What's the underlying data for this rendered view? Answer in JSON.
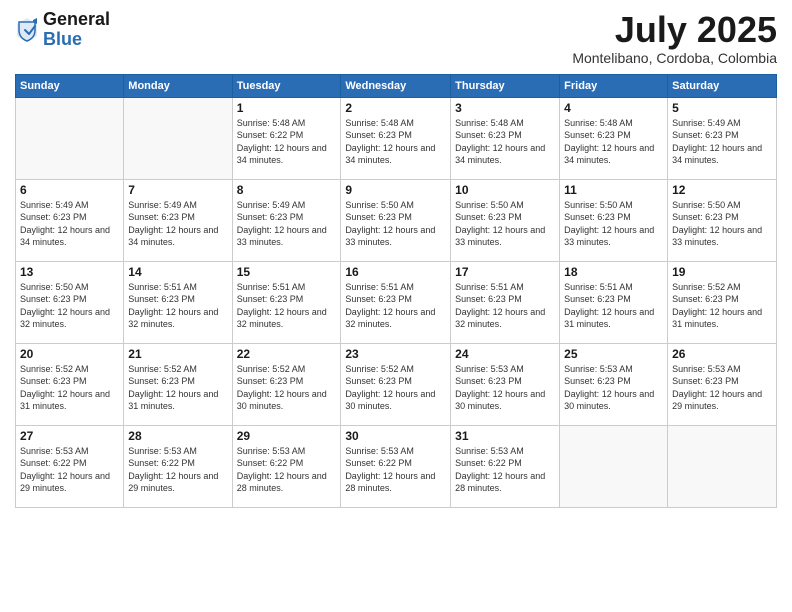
{
  "header": {
    "logo_general": "General",
    "logo_blue": "Blue",
    "month_title": "July 2025",
    "location": "Montelibano, Cordoba, Colombia"
  },
  "weekdays": [
    "Sunday",
    "Monday",
    "Tuesday",
    "Wednesday",
    "Thursday",
    "Friday",
    "Saturday"
  ],
  "weeks": [
    [
      {
        "day": "",
        "empty": true
      },
      {
        "day": "",
        "empty": true
      },
      {
        "day": "1",
        "sunrise": "5:48 AM",
        "sunset": "6:22 PM",
        "daylight": "12 hours and 34 minutes."
      },
      {
        "day": "2",
        "sunrise": "5:48 AM",
        "sunset": "6:23 PM",
        "daylight": "12 hours and 34 minutes."
      },
      {
        "day": "3",
        "sunrise": "5:48 AM",
        "sunset": "6:23 PM",
        "daylight": "12 hours and 34 minutes."
      },
      {
        "day": "4",
        "sunrise": "5:48 AM",
        "sunset": "6:23 PM",
        "daylight": "12 hours and 34 minutes."
      },
      {
        "day": "5",
        "sunrise": "5:49 AM",
        "sunset": "6:23 PM",
        "daylight": "12 hours and 34 minutes."
      }
    ],
    [
      {
        "day": "6",
        "sunrise": "5:49 AM",
        "sunset": "6:23 PM",
        "daylight": "12 hours and 34 minutes."
      },
      {
        "day": "7",
        "sunrise": "5:49 AM",
        "sunset": "6:23 PM",
        "daylight": "12 hours and 34 minutes."
      },
      {
        "day": "8",
        "sunrise": "5:49 AM",
        "sunset": "6:23 PM",
        "daylight": "12 hours and 33 minutes."
      },
      {
        "day": "9",
        "sunrise": "5:50 AM",
        "sunset": "6:23 PM",
        "daylight": "12 hours and 33 minutes."
      },
      {
        "day": "10",
        "sunrise": "5:50 AM",
        "sunset": "6:23 PM",
        "daylight": "12 hours and 33 minutes."
      },
      {
        "day": "11",
        "sunrise": "5:50 AM",
        "sunset": "6:23 PM",
        "daylight": "12 hours and 33 minutes."
      },
      {
        "day": "12",
        "sunrise": "5:50 AM",
        "sunset": "6:23 PM",
        "daylight": "12 hours and 33 minutes."
      }
    ],
    [
      {
        "day": "13",
        "sunrise": "5:50 AM",
        "sunset": "6:23 PM",
        "daylight": "12 hours and 32 minutes."
      },
      {
        "day": "14",
        "sunrise": "5:51 AM",
        "sunset": "6:23 PM",
        "daylight": "12 hours and 32 minutes."
      },
      {
        "day": "15",
        "sunrise": "5:51 AM",
        "sunset": "6:23 PM",
        "daylight": "12 hours and 32 minutes."
      },
      {
        "day": "16",
        "sunrise": "5:51 AM",
        "sunset": "6:23 PM",
        "daylight": "12 hours and 32 minutes."
      },
      {
        "day": "17",
        "sunrise": "5:51 AM",
        "sunset": "6:23 PM",
        "daylight": "12 hours and 32 minutes."
      },
      {
        "day": "18",
        "sunrise": "5:51 AM",
        "sunset": "6:23 PM",
        "daylight": "12 hours and 31 minutes."
      },
      {
        "day": "19",
        "sunrise": "5:52 AM",
        "sunset": "6:23 PM",
        "daylight": "12 hours and 31 minutes."
      }
    ],
    [
      {
        "day": "20",
        "sunrise": "5:52 AM",
        "sunset": "6:23 PM",
        "daylight": "12 hours and 31 minutes."
      },
      {
        "day": "21",
        "sunrise": "5:52 AM",
        "sunset": "6:23 PM",
        "daylight": "12 hours and 31 minutes."
      },
      {
        "day": "22",
        "sunrise": "5:52 AM",
        "sunset": "6:23 PM",
        "daylight": "12 hours and 30 minutes."
      },
      {
        "day": "23",
        "sunrise": "5:52 AM",
        "sunset": "6:23 PM",
        "daylight": "12 hours and 30 minutes."
      },
      {
        "day": "24",
        "sunrise": "5:53 AM",
        "sunset": "6:23 PM",
        "daylight": "12 hours and 30 minutes."
      },
      {
        "day": "25",
        "sunrise": "5:53 AM",
        "sunset": "6:23 PM",
        "daylight": "12 hours and 30 minutes."
      },
      {
        "day": "26",
        "sunrise": "5:53 AM",
        "sunset": "6:23 PM",
        "daylight": "12 hours and 29 minutes."
      }
    ],
    [
      {
        "day": "27",
        "sunrise": "5:53 AM",
        "sunset": "6:22 PM",
        "daylight": "12 hours and 29 minutes."
      },
      {
        "day": "28",
        "sunrise": "5:53 AM",
        "sunset": "6:22 PM",
        "daylight": "12 hours and 29 minutes."
      },
      {
        "day": "29",
        "sunrise": "5:53 AM",
        "sunset": "6:22 PM",
        "daylight": "12 hours and 28 minutes."
      },
      {
        "day": "30",
        "sunrise": "5:53 AM",
        "sunset": "6:22 PM",
        "daylight": "12 hours and 28 minutes."
      },
      {
        "day": "31",
        "sunrise": "5:53 AM",
        "sunset": "6:22 PM",
        "daylight": "12 hours and 28 minutes."
      },
      {
        "day": "",
        "empty": true
      },
      {
        "day": "",
        "empty": true
      }
    ]
  ],
  "labels": {
    "sunrise": "Sunrise:",
    "sunset": "Sunset:",
    "daylight": "Daylight:"
  }
}
